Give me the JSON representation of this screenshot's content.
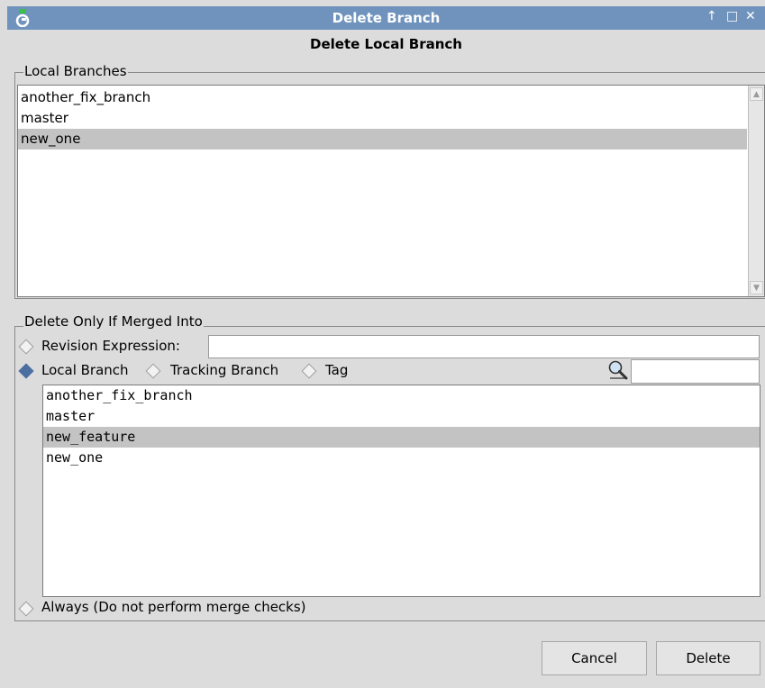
{
  "window": {
    "title": "Delete Branch"
  },
  "dialog": {
    "heading": "Delete Local Branch"
  },
  "local_branches": {
    "legend": "Local Branches",
    "items": [
      {
        "label": "another_fix_branch"
      },
      {
        "label": "master"
      },
      {
        "label": "new_one",
        "selected": true
      }
    ]
  },
  "merged_into": {
    "legend": "Delete Only If Merged Into",
    "revision_expression": {
      "label": "Revision Expression:",
      "value": "",
      "selected": false
    },
    "local_branch": {
      "label": "Local Branch",
      "selected": true
    },
    "tracking_branch": {
      "label": "Tracking Branch",
      "selected": false
    },
    "tag": {
      "label": "Tag",
      "selected": false
    },
    "filter_value": "",
    "branches": [
      {
        "label": "another_fix_branch"
      },
      {
        "label": "master"
      },
      {
        "label": "new_feature",
        "selected": true
      },
      {
        "label": "new_one"
      }
    ],
    "always": {
      "label": "Always (Do not perform merge checks)",
      "selected": false
    }
  },
  "buttons": {
    "cancel": "Cancel",
    "delete": "Delete"
  }
}
